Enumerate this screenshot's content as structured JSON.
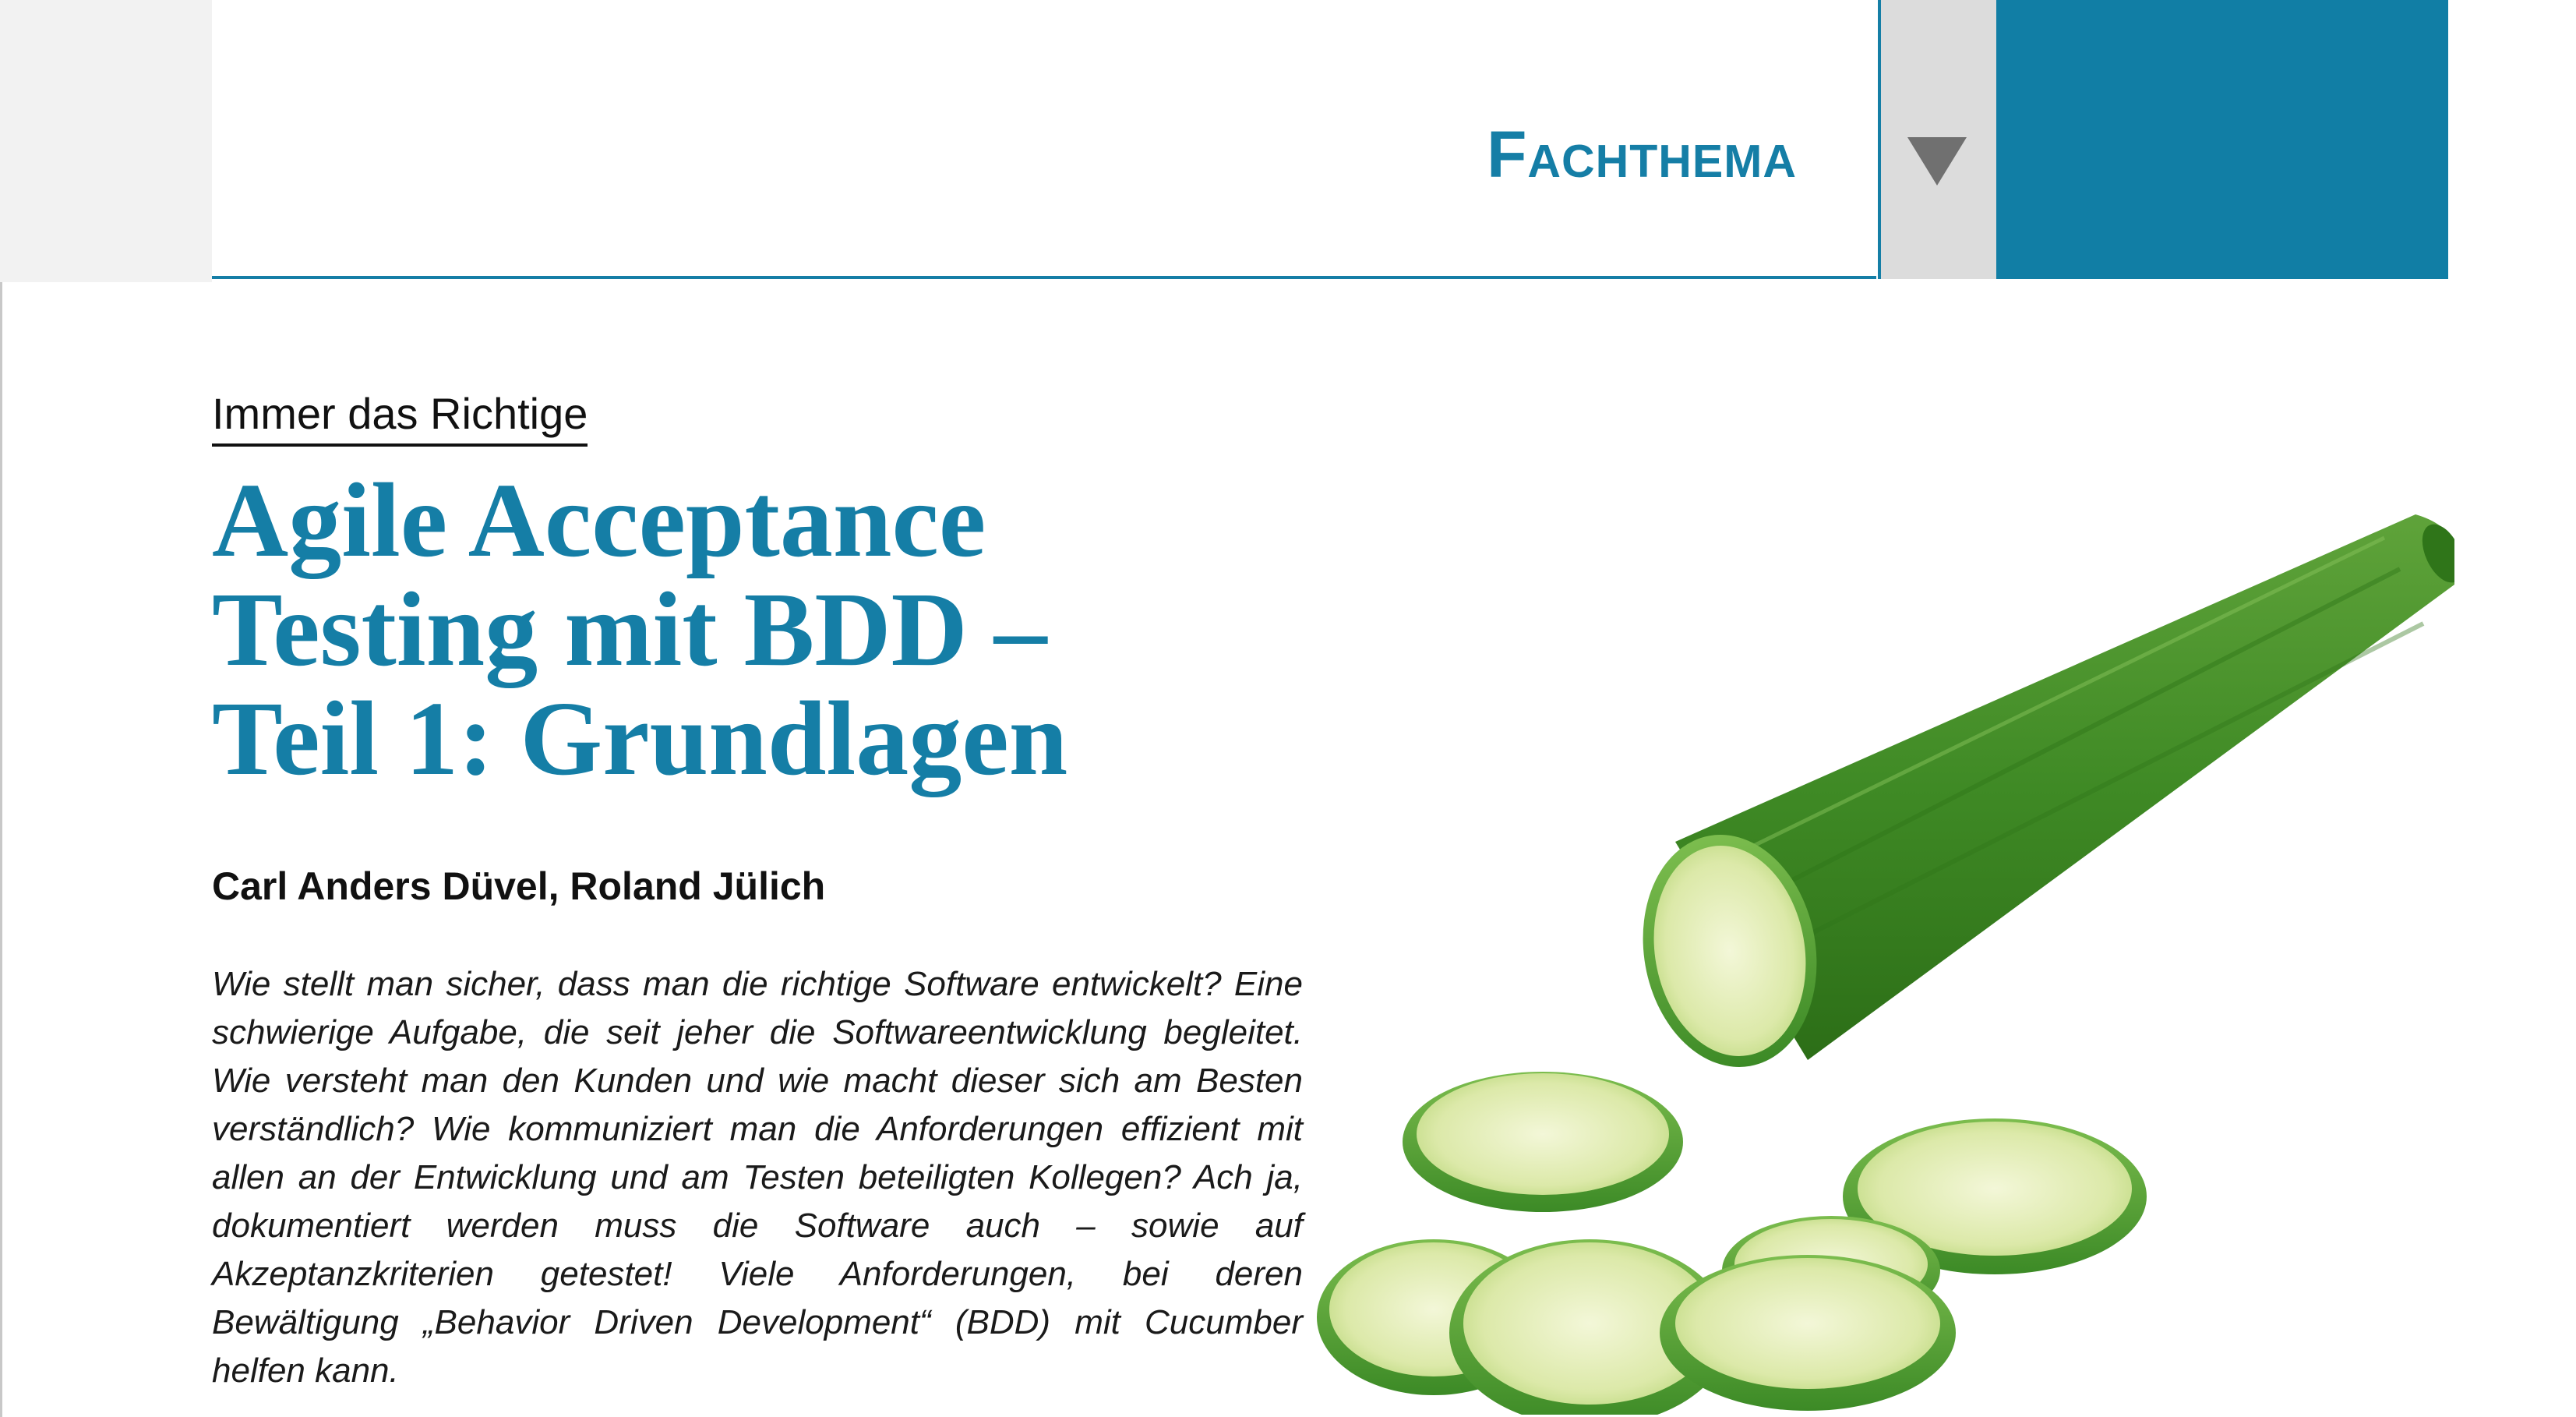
{
  "header": {
    "section_label": "Fachthema",
    "arrow_icon": "triangle-down-icon",
    "accent_color": "#157ea6"
  },
  "article": {
    "kicker": "Immer das Richtige",
    "title_line_1": "Agile Acceptance",
    "title_line_2": "Testing mit BDD –",
    "title_line_3": "Teil 1: Grundlagen",
    "authors": "Carl Anders Düvel, Roland Jülich",
    "abstract": "Wie stellt man sicher, dass man die richtige Software entwickelt? Eine schwierige Aufgabe, die seit jeher die Softwareentwicklung begleitet. Wie versteht man den Kunden und wie macht dieser sich am Besten verständlich? Wie kommuniziert man die Anforderungen effizient mit allen an der Entwicklung und am Testen beteiligten Kollegen? Ach ja, dokumentiert werden muss die Software auch – sowie auf Akzeptanzkriterien getestet! Viele Anforderungen, bei deren Bewältigung „Behavior Driven Development“ (BDD) mit Cucumber helfen kann."
  },
  "illustration": {
    "icon": "cucumber-image"
  }
}
